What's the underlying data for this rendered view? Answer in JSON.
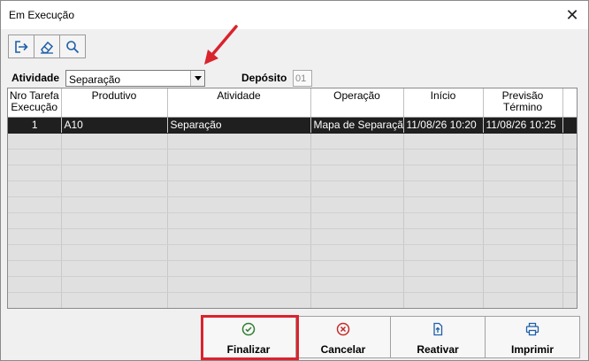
{
  "window": {
    "title": "Em Execução"
  },
  "toolbar": {
    "buttons": [
      "exit-icon",
      "eraser-icon",
      "search-icon"
    ]
  },
  "filter": {
    "atividade_label": "Atividade",
    "atividade_value": "Separação",
    "deposito_label": "Depósito",
    "deposito_value": "01"
  },
  "grid": {
    "headers": [
      [
        "Nro Tarefa",
        "Execução"
      ],
      [
        "Produtivo",
        ""
      ],
      [
        "Atividade",
        ""
      ],
      [
        "Operação",
        ""
      ],
      [
        "Início",
        ""
      ],
      [
        "Previsão",
        "Término"
      ]
    ],
    "rows": [
      {
        "tarefa": "1",
        "produtivo": "A10",
        "atividade": "Separação",
        "operacao": "Mapa de Separação",
        "inicio": "11/08/26  10:20",
        "previsao": "11/08/26  10:25"
      }
    ]
  },
  "actions": {
    "finalizar": "Finalizar",
    "cancelar": "Cancelar",
    "reativar": "Reativar",
    "imprimir": "Imprimir"
  },
  "colors": {
    "accent_red": "#d9232d",
    "icon_green": "#2e7d32",
    "icon_red": "#c62828",
    "icon_blue": "#1e5fa8"
  }
}
